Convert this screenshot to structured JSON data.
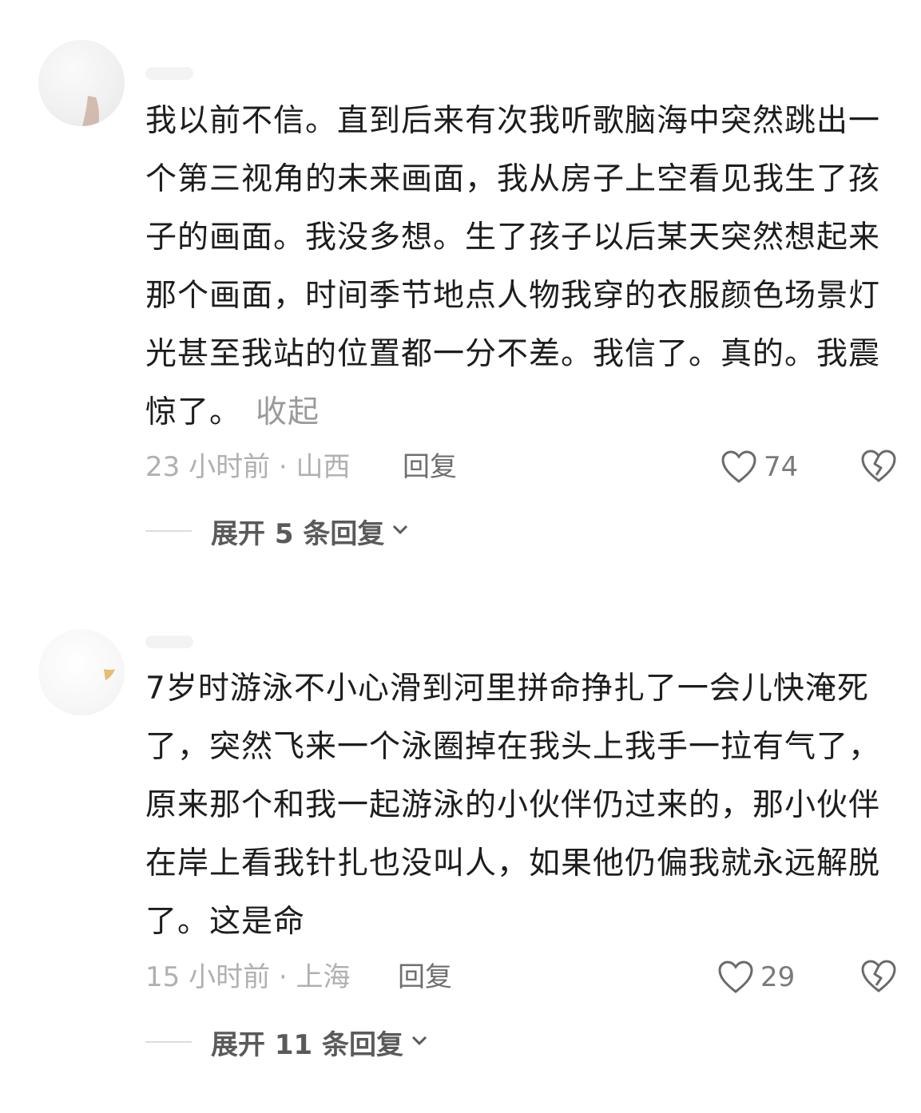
{
  "comments": [
    {
      "text": "我以前不信。直到后来有次我听歌脑海中突然跳出一个第三视角的未来画面，我从房子上空看见我生了孩子的画面。我没多想。生了孩子以后某天突然想起来那个画面，时间季节地点人物我穿的衣服颜色场景灯光甚至我站的位置都一分不差。我信了。真的。我震惊了。",
      "collapse_label": "收起",
      "meta": "23 小时前 · 山西",
      "reply_label": "回复",
      "likes": "74",
      "expand_label": "展开 5 条回复"
    },
    {
      "text": "7岁时游泳不小心滑到河里拼命挣扎了一会儿快淹死了，突然飞来一个泳圈掉在我头上我手一拉有气了，原来那个和我一起游泳的小伙伴仍过来的，那小伙伴在岸上看我针扎也没叫人，如果他仍偏我就永远解脱了。这是命",
      "meta": "15 小时前 · 上海",
      "reply_label": "回复",
      "likes": "29",
      "expand_label": "展开 11 条回复"
    }
  ],
  "icons": {
    "like": "heart-outline-icon",
    "dislike": "broken-heart-icon",
    "expand": "chevron-down-icon"
  },
  "colors": {
    "text": "#1d1d1d",
    "meta": "#b0b0b0",
    "action": "#6f6f6f"
  }
}
